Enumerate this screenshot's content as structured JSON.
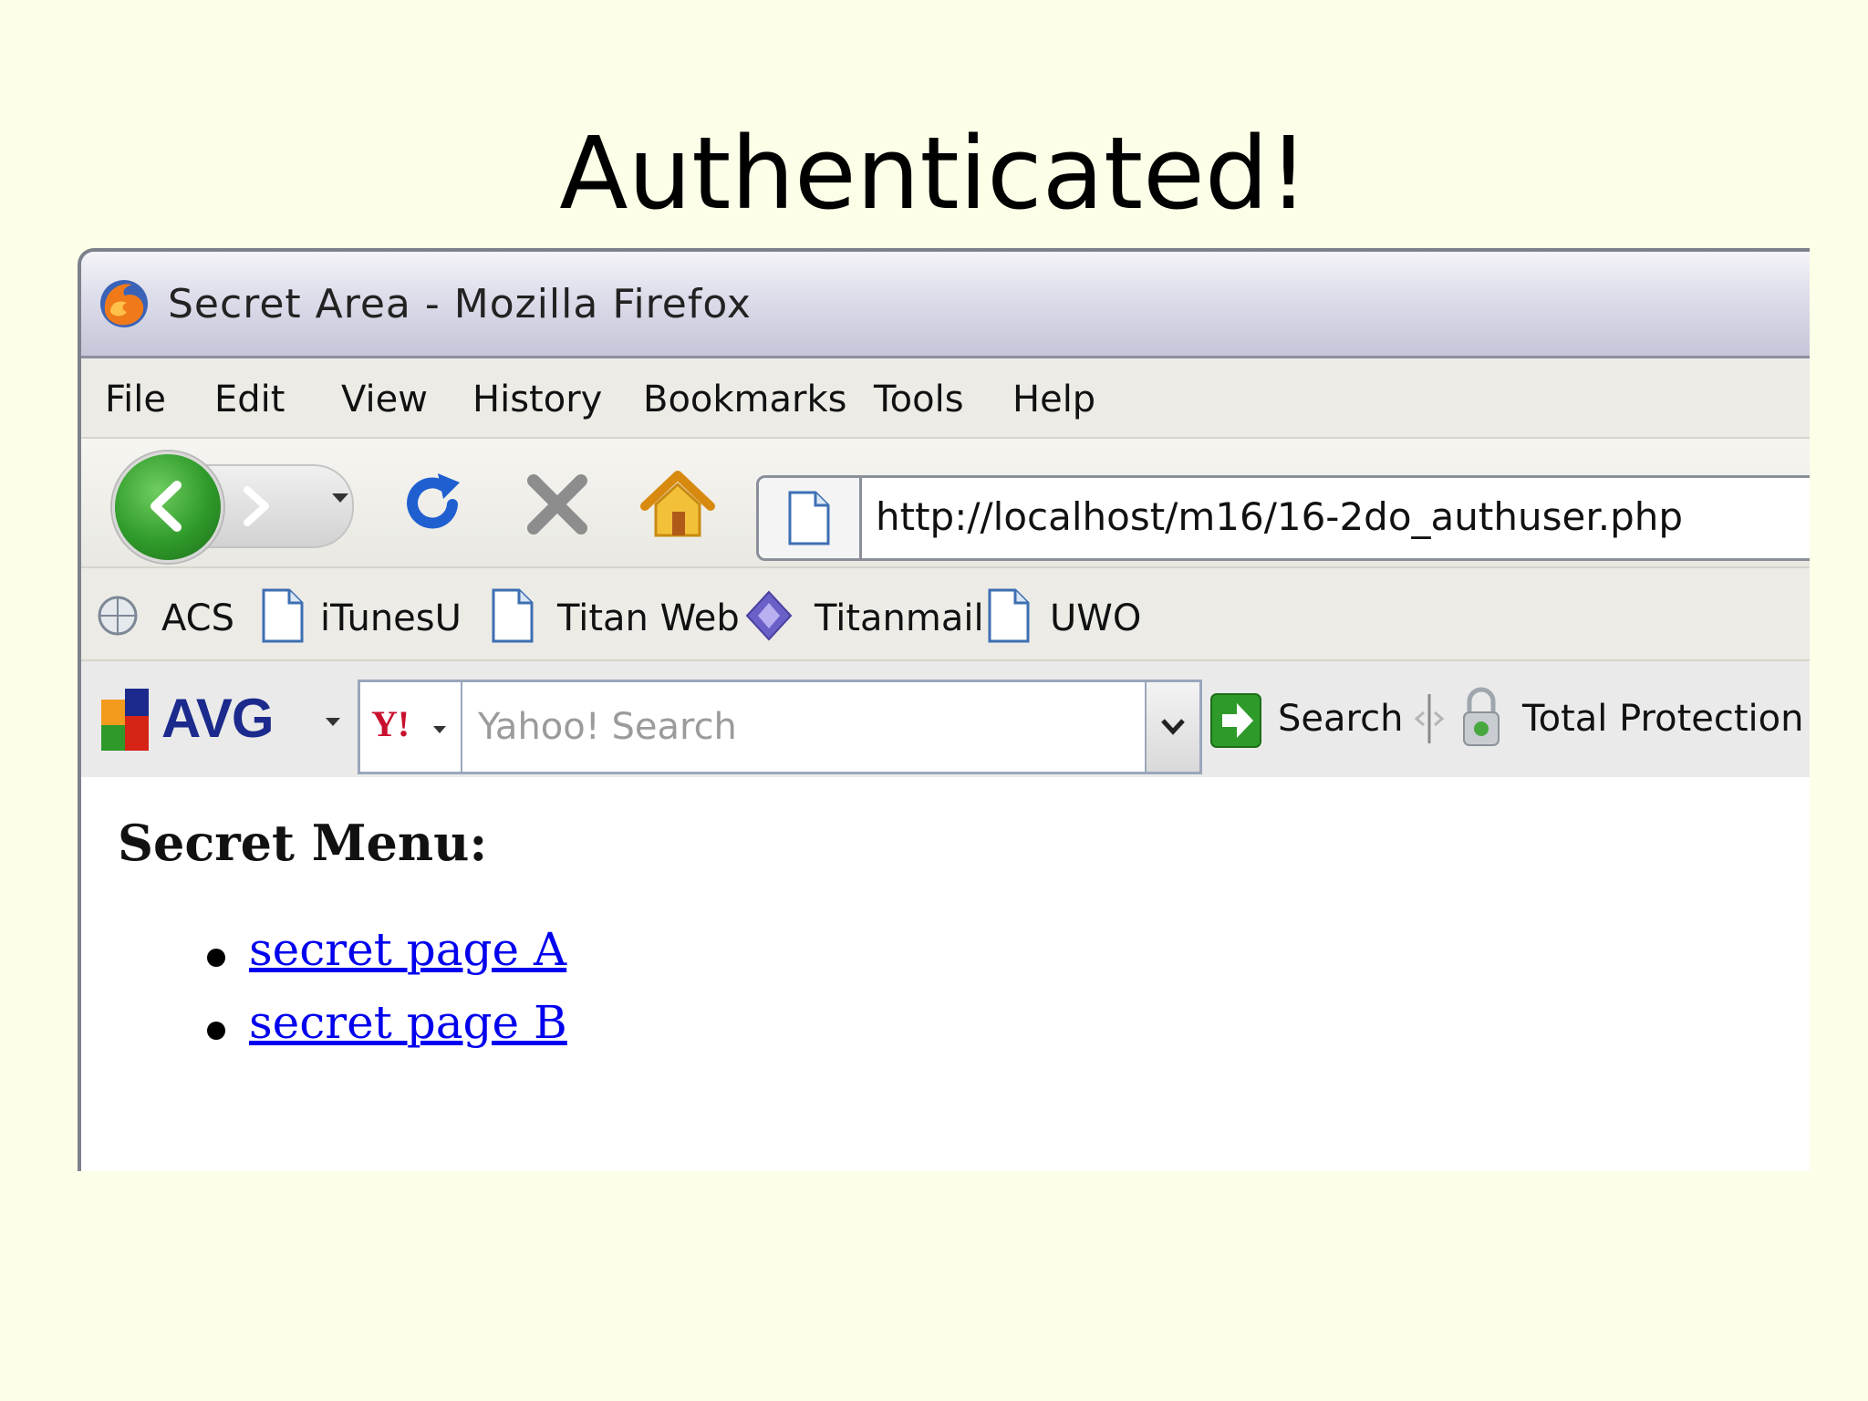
{
  "slide": {
    "title": "Authenticated!"
  },
  "window": {
    "title": "Secret Area - Mozilla Firefox"
  },
  "menu": [
    "File",
    "Edit",
    "View",
    "History",
    "Bookmarks",
    "Tools",
    "Help"
  ],
  "navigation": {
    "url": "http://localhost/m16/16-2do_authuser.php"
  },
  "bookmarks": [
    "ACS",
    "iTunesU",
    "Titan Web",
    "Titanmail",
    "UWO"
  ],
  "toolbar": {
    "avg_label": "AVG",
    "yahoo_logo": "Y!",
    "search_placeholder": "Yahoo! Search",
    "search_button": "Search",
    "protection_label": "Total Protection"
  },
  "page": {
    "heading": "Secret Menu:",
    "links": [
      "secret page A",
      "secret page B"
    ]
  },
  "colors": {
    "background": "#fdfee8",
    "link": "#0000ee",
    "back_button": "#2f9a2a"
  }
}
